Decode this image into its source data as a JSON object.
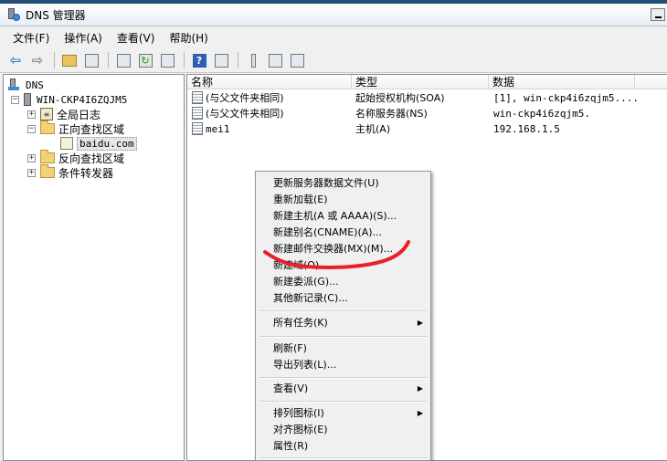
{
  "window": {
    "title": "DNS 管理器",
    "accent": "#1f4e79"
  },
  "menubar": [
    {
      "label": "文件(F)"
    },
    {
      "label": "操作(A)"
    },
    {
      "label": "查看(V)"
    },
    {
      "label": "帮助(H)"
    }
  ],
  "toolbar": {
    "icons": [
      "back-icon",
      "forward-icon",
      "up-folder-icon",
      "show-tree-icon",
      "properties-icon",
      "refresh-icon",
      "export-icon",
      "help-icon",
      "console-icon",
      "filter-icon",
      "list-icon",
      "copy-icon"
    ]
  },
  "tree": {
    "root": "DNS",
    "server": "WIN-CKP4I6ZQJM5",
    "global_logs": "全局日志",
    "forward_zones": "正向查找区域",
    "zone_selected": "baidu.com",
    "reverse_zones": "反向查找区域",
    "conditional_forwarders": "条件转发器"
  },
  "list": {
    "columns": [
      "名称",
      "类型",
      "数据"
    ],
    "rows": [
      {
        "name": "(与父文件夹相同)",
        "type": "起始授权机构(SOA)",
        "data": "[1], win-ckp4i6zqjm5...."
      },
      {
        "name": "(与父文件夹相同)",
        "type": "名称服务器(NS)",
        "data": "win-ckp4i6zqjm5."
      },
      {
        "name": "mei1",
        "type": "主机(A)",
        "data": "192.168.1.5"
      }
    ]
  },
  "context_menu": {
    "items": [
      {
        "label": "更新服务器数据文件(U)"
      },
      {
        "label": "重新加载(E)"
      },
      {
        "label": "新建主机(A 或 AAAA)(S)..."
      },
      {
        "label": "新建别名(CNAME)(A)..."
      },
      {
        "label": "新建邮件交换器(MX)(M)..."
      },
      {
        "label": "新建域(O)..."
      },
      {
        "label": "新建委派(G)..."
      },
      {
        "label": "其他新记录(C)..."
      },
      {
        "label": "所有任务(K)"
      },
      {
        "label": "刷新(F)"
      },
      {
        "label": "导出列表(L)..."
      },
      {
        "label": "查看(V)"
      },
      {
        "label": "排列图标(I)"
      },
      {
        "label": "对齐图标(E)"
      },
      {
        "label": "属性(R)"
      }
    ],
    "highlight_color": "#e8202a"
  }
}
